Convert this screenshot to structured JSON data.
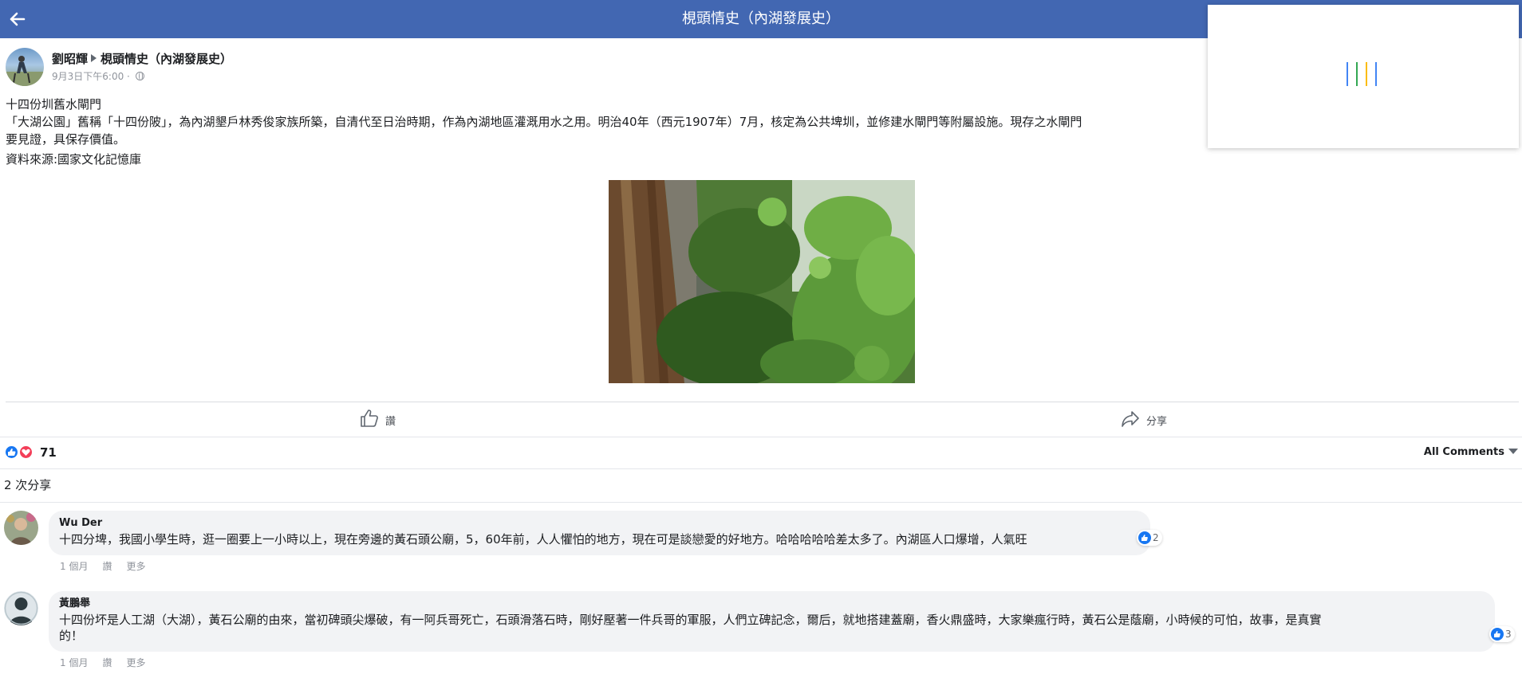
{
  "topbar": {
    "title": "梘頭情史（內湖發展史）"
  },
  "post": {
    "author": "劉昭輝",
    "group": "梘頭情史（內湖發展史）",
    "timestamp": "9月3日下午6:00 ·",
    "title_line": "十四份圳舊水閘門",
    "body_line1": "「大湖公園」舊稱「十四份陂」，為內湖墾戶林秀俊家族所築，自清代至日治時期，作為內湖地區灌溉用水之用。明治40年（西元1907年）7月，核定為公共埤圳，並修建水閘門等附屬設施。現存之水閘門",
    "body_line2": "要見證，具保存價值。",
    "source": "資料來源:國家文化記憶庫"
  },
  "actions": {
    "like_label": "讚",
    "share_label": "分享"
  },
  "reactions": {
    "count": "71",
    "filter_label": "All Comments"
  },
  "shares": {
    "label": "2 次分享"
  },
  "comments": [
    {
      "name": "Wu Der",
      "text": "十四分埤，我國小學生時，逛一圈要上一小時以上，現在旁邊的黃石頭公廟，5，60年前，人人懼怕的地方，現在可是談戀愛的好地方。哈哈哈哈哈差太多了。內湖區人口爆增，人氣旺",
      "likes": "2",
      "time": "1 個月",
      "like_label": "讚",
      "more_label": "更多"
    },
    {
      "name": "黃鵬舉",
      "text_line1": "十四份坏是人工湖（大湖），黃石公廟的由來，當初碑頭尖爆破，有一阿兵哥死亡，石頭滑落石時，剛好壓著一件兵哥的軍服，人們立碑記念，爾后，就地搭建蓋廟，香火鼎盛時，大家樂瘋行時，黃石公是蔭廟，小時候的可怕，故事，是真實",
      "text_line2": "的！",
      "likes": "3",
      "time": "1 個月",
      "like_label": "讚",
      "more_label": "更多"
    }
  ],
  "colors": {
    "header": "#4267b2",
    "link_blue": "#1877f2",
    "bubble": "#f2f3f5",
    "muted": "#90949c"
  },
  "icons": {
    "back": "arrow-left-icon",
    "like": "thumbs-up-icon",
    "share": "share-arrow-icon",
    "globe": "globe-icon",
    "caret": "caret-down-icon"
  }
}
